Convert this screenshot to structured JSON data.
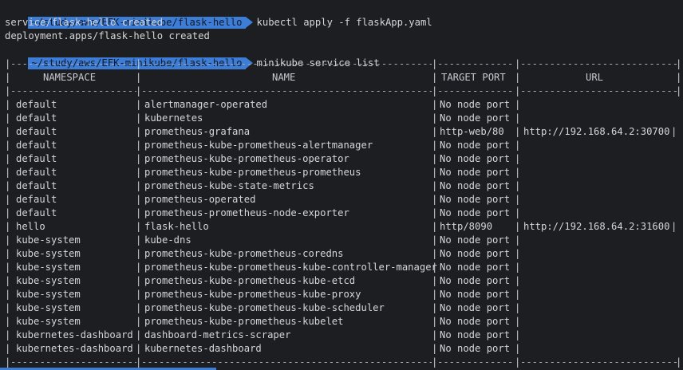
{
  "prompt": {
    "path": "~/study/aws/EFK-minikube/flask-hello"
  },
  "commands": [
    {
      "text": "kubectl apply -f flaskApp.yaml"
    },
    {
      "text": "minikube service list"
    }
  ],
  "outputs": [
    "service/flask-hello created",
    "deployment.apps/flask-hello created"
  ],
  "table": {
    "headers": {
      "namespace": "NAMESPACE",
      "name": "NAME",
      "target_port": "TARGET PORT",
      "url": "URL"
    },
    "rows": [
      {
        "namespace": "default",
        "name": "alertmanager-operated",
        "port": "No node port",
        "url": ""
      },
      {
        "namespace": "default",
        "name": "kubernetes",
        "port": "No node port",
        "url": ""
      },
      {
        "namespace": "default",
        "name": "prometheus-grafana",
        "port": "http-web/80",
        "url": "http://192.168.64.2:30700"
      },
      {
        "namespace": "default",
        "name": "prometheus-kube-prometheus-alertmanager",
        "port": "No node port",
        "url": ""
      },
      {
        "namespace": "default",
        "name": "prometheus-kube-prometheus-operator",
        "port": "No node port",
        "url": ""
      },
      {
        "namespace": "default",
        "name": "prometheus-kube-prometheus-prometheus",
        "port": "No node port",
        "url": ""
      },
      {
        "namespace": "default",
        "name": "prometheus-kube-state-metrics",
        "port": "No node port",
        "url": ""
      },
      {
        "namespace": "default",
        "name": "prometheus-operated",
        "port": "No node port",
        "url": ""
      },
      {
        "namespace": "default",
        "name": "prometheus-prometheus-node-exporter",
        "port": "No node port",
        "url": ""
      },
      {
        "namespace": "hello",
        "name": "flask-hello",
        "port": "http/8090",
        "url": "http://192.168.64.2:31600"
      },
      {
        "namespace": "kube-system",
        "name": "kube-dns",
        "port": "No node port",
        "url": ""
      },
      {
        "namespace": "kube-system",
        "name": "prometheus-kube-prometheus-coredns",
        "port": "No node port",
        "url": ""
      },
      {
        "namespace": "kube-system",
        "name": "prometheus-kube-prometheus-kube-controller-manager",
        "port": "No node port",
        "url": ""
      },
      {
        "namespace": "kube-system",
        "name": "prometheus-kube-prometheus-kube-etcd",
        "port": "No node port",
        "url": ""
      },
      {
        "namespace": "kube-system",
        "name": "prometheus-kube-prometheus-kube-proxy",
        "port": "No node port",
        "url": ""
      },
      {
        "namespace": "kube-system",
        "name": "prometheus-kube-prometheus-kube-scheduler",
        "port": "No node port",
        "url": ""
      },
      {
        "namespace": "kube-system",
        "name": "prometheus-kube-prometheus-kubelet",
        "port": "No node port",
        "url": ""
      },
      {
        "namespace": "kubernetes-dashboard",
        "name": "dashboard-metrics-scraper",
        "port": "No node port",
        "url": ""
      },
      {
        "namespace": "kubernetes-dashboard",
        "name": "kubernetes-dashboard",
        "port": "No node port",
        "url": ""
      }
    ]
  },
  "colors": {
    "background": "#1c1e22",
    "prompt_bg": "#3e7dd6",
    "text": "#d4d6da"
  }
}
